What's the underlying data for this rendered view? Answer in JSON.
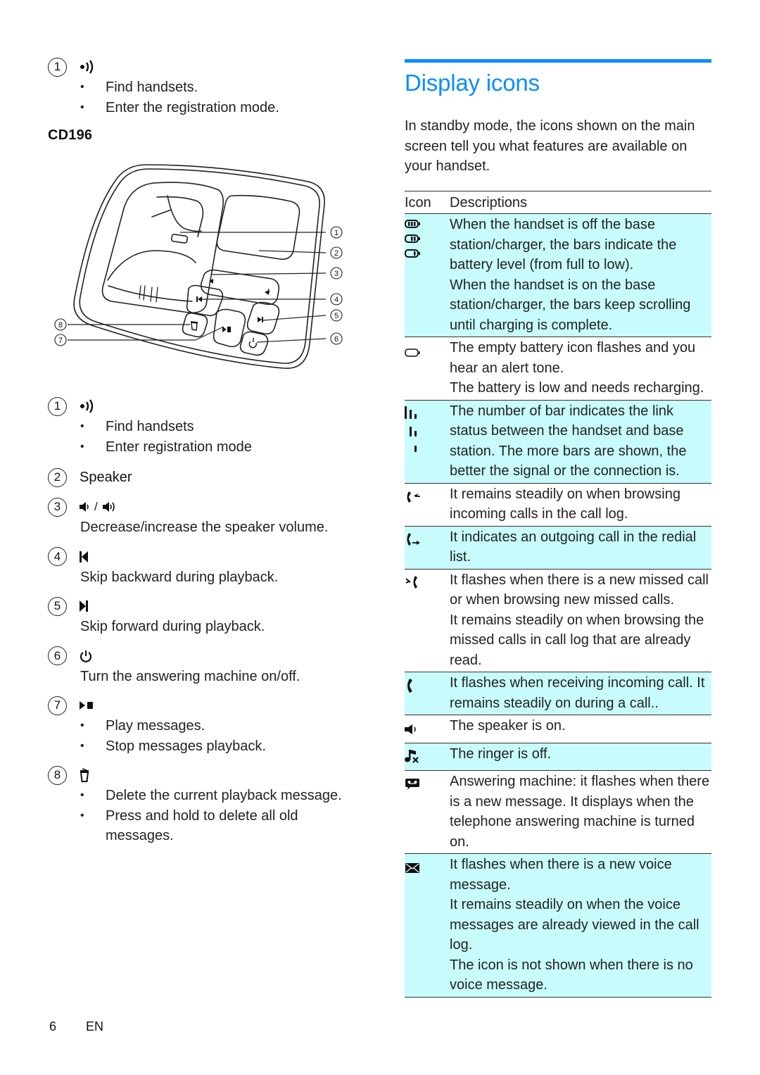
{
  "left": {
    "intro_item": {
      "number": "1",
      "icon": "signal-find-icon",
      "bullets": [
        "Find handsets.",
        "Enter the registration mode."
      ]
    },
    "model_name": "CD196",
    "diagram_callouts": [
      "1",
      "2",
      "3",
      "4",
      "5",
      "6",
      "7",
      "8"
    ],
    "items": [
      {
        "number": "1",
        "icon": "signal-find-icon",
        "bullets": [
          "Find handsets",
          "Enter registration mode"
        ]
      },
      {
        "number": "2",
        "label": "Speaker"
      },
      {
        "number": "3",
        "icon": "volume-down-up-icon",
        "separator": "/",
        "description": "Decrease/increase the speaker volume."
      },
      {
        "number": "4",
        "icon": "skip-backward-icon",
        "description": "Skip backward during playback."
      },
      {
        "number": "5",
        "icon": "skip-forward-icon",
        "description": "Skip forward during playback."
      },
      {
        "number": "6",
        "icon": "power-icon",
        "description": "Turn the answering machine on/off."
      },
      {
        "number": "7",
        "icon": "play-stop-icon",
        "bullets": [
          "Play messages.",
          "Stop messages playback."
        ]
      },
      {
        "number": "8",
        "icon": "trash-icon",
        "bullets": [
          "Delete the current playback message.",
          "Press and hold to delete all old messages."
        ]
      }
    ]
  },
  "right": {
    "title": "Display icons",
    "intro": "In standby mode, the icons shown on the main screen tell you what features are available on your handset.",
    "table": {
      "headers": [
        "Icon",
        "Descriptions"
      ],
      "rows": [
        {
          "icons": [
            "battery-full-icon",
            "battery-two-bars-icon",
            "battery-one-bar-icon"
          ],
          "shaded": true,
          "lines": [
            "When the handset is off the base station/charger, the bars indicate the battery level (from full to low).",
            "When the handset is on the base station/charger, the bars keep scrolling until charging is complete."
          ]
        },
        {
          "icons": [
            "battery-empty-icon"
          ],
          "shaded": false,
          "lines": [
            "The empty battery icon flashes and you hear an alert tone.",
            "The battery is low and needs recharging."
          ]
        },
        {
          "icons": [
            "signal-three-bars-icon",
            "signal-two-bars-icon",
            "signal-one-bar-icon"
          ],
          "shaded": true,
          "lines": [
            "The number of bar indicates the link status between the handset and base station. The more bars are shown, the better the signal or the connection is."
          ]
        },
        {
          "icons": [
            "incoming-call-log-icon"
          ],
          "shaded": false,
          "lines": [
            "It remains steadily on when browsing incoming calls in the call log."
          ]
        },
        {
          "icons": [
            "outgoing-call-icon"
          ],
          "shaded": true,
          "lines": [
            "It indicates an outgoing call in the redial list."
          ]
        },
        {
          "icons": [
            "missed-call-icon"
          ],
          "shaded": false,
          "lines": [
            "It flashes when there is a new missed call or when browsing new missed calls.",
            "It remains steadily on when browsing the missed calls in call log that are already read."
          ]
        },
        {
          "icons": [
            "phone-call-icon"
          ],
          "shaded": true,
          "lines": [
            "It flashes when receiving incoming call. It remains steadily on during a call.."
          ]
        },
        {
          "icons": [
            "speaker-on-icon"
          ],
          "shaded": false,
          "lines": [
            "The speaker is on."
          ]
        },
        {
          "icons": [
            "ringer-off-icon"
          ],
          "shaded": true,
          "lines": [
            "The ringer is off."
          ]
        },
        {
          "icons": [
            "answering-machine-icon"
          ],
          "shaded": false,
          "lines": [
            "Answering machine: it flashes when there is a new message. It displays when the telephone answering machine is turned on."
          ]
        },
        {
          "icons": [
            "voice-message-envelope-icon"
          ],
          "shaded": true,
          "lines": [
            "It flashes when there is a new voice message.",
            "It remains steadily on when the voice messages are already viewed in the call log.",
            "The icon is not shown when there is no voice message."
          ]
        }
      ]
    }
  },
  "footer": {
    "page_number": "6",
    "language": "EN"
  },
  "colors": {
    "accent": "#0a8dff",
    "row_shade": "#c8fcfc",
    "text": "#222222"
  }
}
